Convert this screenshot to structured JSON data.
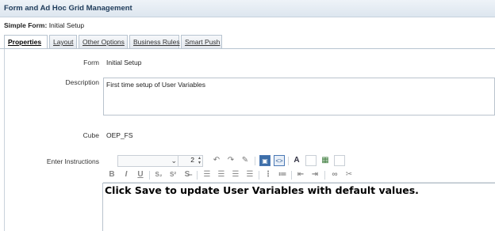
{
  "window": {
    "title": "Form and Ad Hoc Grid Management"
  },
  "form": {
    "label": "Simple Form:",
    "name": "Initial Setup"
  },
  "tabs": [
    {
      "label": "Properties",
      "active": true
    },
    {
      "label": "Layout",
      "active": false
    },
    {
      "label": "Other Options",
      "active": false
    },
    {
      "label": "Business Rules",
      "active": false
    },
    {
      "label": "Smart Push",
      "active": false
    }
  ],
  "properties": {
    "form_label": "Form",
    "form_value": "Initial Setup",
    "description_label": "Description",
    "description_value": "First time setup of User Variables",
    "cube_label": "Cube",
    "cube_value": "OEP_FS",
    "instructions_label": "Enter Instructions"
  },
  "editor": {
    "font_size": "2",
    "content": "Click Save to update User Variables with default values."
  },
  "toolbar_icons": {
    "row1": [
      "font-family-dropdown",
      "font-size-spinner",
      "undo-icon",
      "redo-icon",
      "eraser-icon",
      "design-view-icon",
      "source-view-icon",
      "text-color-icon",
      "highlight-color-icon",
      "table-icon",
      "background-color-icon"
    ],
    "row2": [
      "bold-icon",
      "italic-icon",
      "underline-icon",
      "subscript-icon",
      "superscript-icon",
      "strikethrough-icon",
      "align-left-icon",
      "align-center-icon",
      "align-right-icon",
      "justify-icon",
      "numbered-list-icon",
      "bullet-list-icon",
      "outdent-icon",
      "indent-icon",
      "link-icon",
      "unlink-icon"
    ]
  },
  "glyphs": {
    "bold": "B",
    "italic": "I",
    "underline": "U",
    "subscript": "S₂",
    "superscript": "S²",
    "strike": "S̶"
  }
}
